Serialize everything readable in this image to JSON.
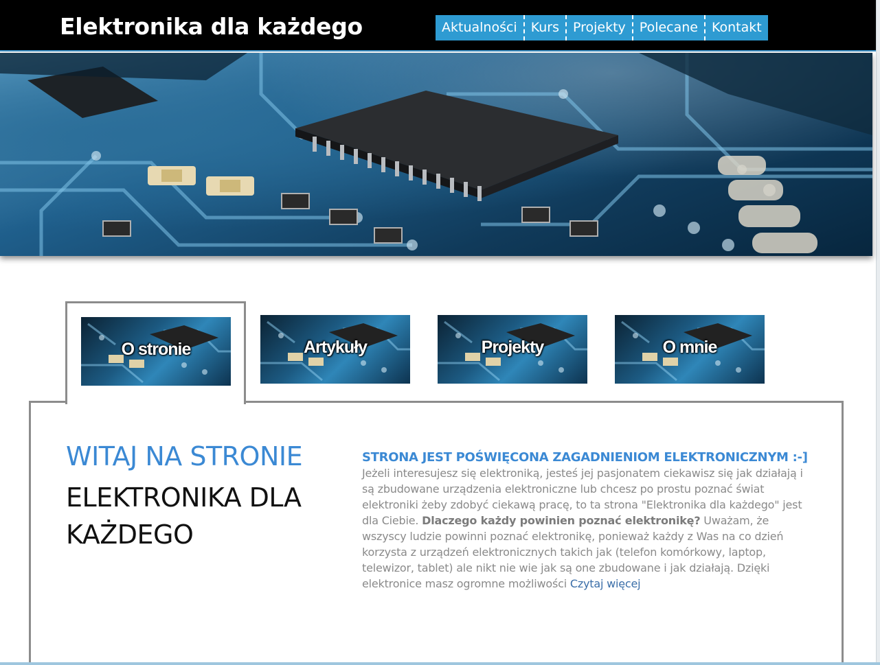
{
  "header": {
    "site_title": "Elektronika dla każdego",
    "nav": [
      {
        "label": "Aktualności"
      },
      {
        "label": "Kurs"
      },
      {
        "label": "Projekty"
      },
      {
        "label": "Polecane"
      },
      {
        "label": "Kontakt"
      }
    ]
  },
  "hero": {
    "icon": "pcb-photo"
  },
  "tabs": [
    {
      "label": "O stronie",
      "active": true
    },
    {
      "label": "Artykuły",
      "active": false
    },
    {
      "label": "Projekty",
      "active": false
    },
    {
      "label": "O mnie",
      "active": false
    }
  ],
  "main": {
    "welcome_line1": "WITAJ NA STRONIE",
    "welcome_line2": "ELEKTRONIKA DLA KAŻDEGO",
    "article_heading": "STRONA JEST POŚWIĘCONA ZAGADNIENIOM ELEKTRONICZNYM :-]",
    "article_text_1": "Jeżeli interesujesz się elektroniką, jesteś jej pasjonatem ciekawisz się jak działają i są zbudowane urządzenia elektroniczne lub chcesz po prostu poznać świat elektroniki żeby zdobyć ciekawą pracę, to ta strona \"Elektronika dla każdego\" jest dla Ciebie. ",
    "article_bold": "Dlaczego każdy powinien poznać elektronikę?",
    "article_text_2": " Uważam, że wszyscy ludzie powinni poznać elektronikę, ponieważ każdy z Was na co dzień korzysta z urządzeń elektronicznych takich jak (telefon komórkowy, laptop, telewizor, tablet) ale nikt nie wie jak są one zbudowane i jak działają. Dzięki elektronice masz ogromne możliwości ",
    "read_more": "Czytaj więcej"
  },
  "colors": {
    "header_bg": "#000000",
    "nav_bg": "#2e9bd2",
    "accent_blue": "#3b89d4",
    "body_text": "#8a8a8a",
    "frame_gray": "#8c8c8c"
  }
}
